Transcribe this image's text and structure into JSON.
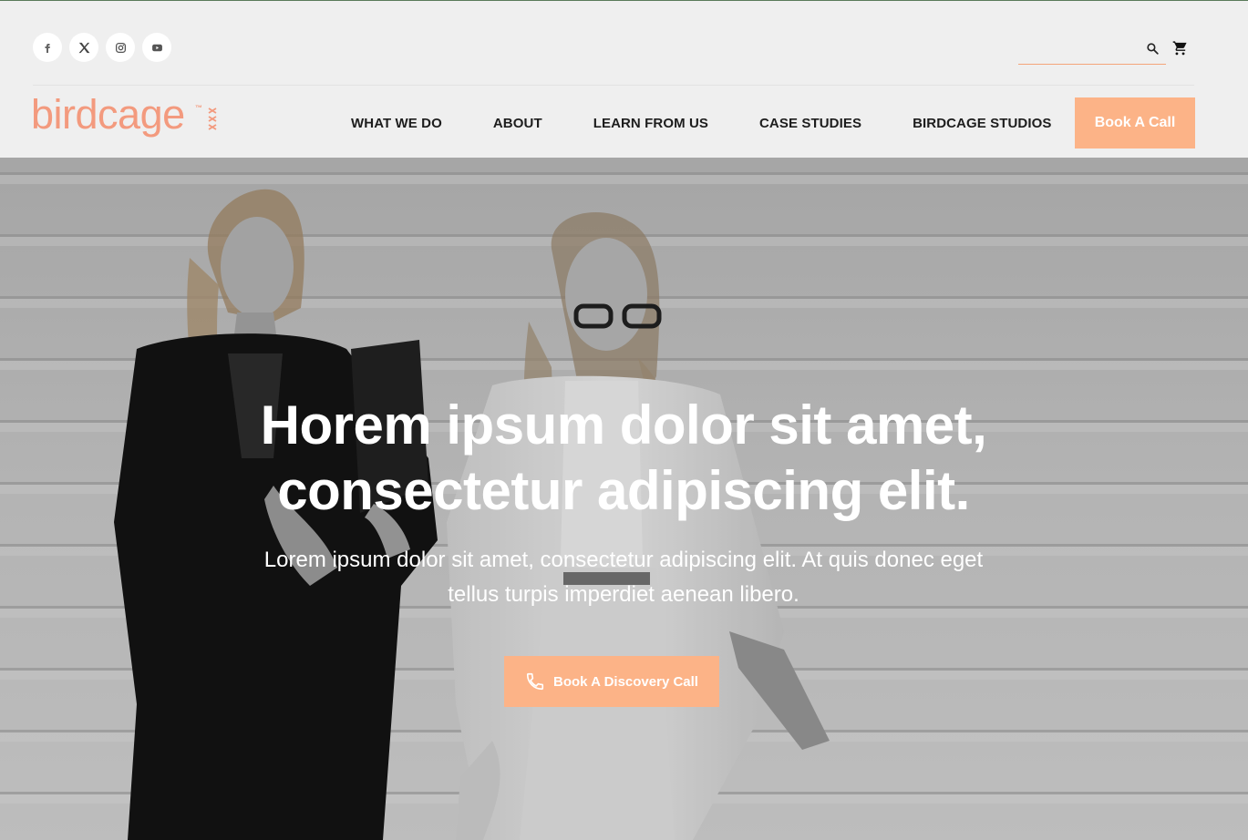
{
  "header": {
    "socials": [
      {
        "name": "facebook",
        "icon": "facebook-icon"
      },
      {
        "name": "x",
        "icon": "x-icon"
      },
      {
        "name": "instagram",
        "icon": "instagram-icon"
      },
      {
        "name": "youtube",
        "icon": "youtube-icon"
      }
    ],
    "search": {
      "placeholder": "",
      "value": ""
    },
    "logo": {
      "text": "birdcage",
      "tm": "™"
    },
    "nav": [
      {
        "label": "WHAT WE DO"
      },
      {
        "label": "ABOUT"
      },
      {
        "label": "LEARN FROM US"
      },
      {
        "label": "CASE STUDIES"
      },
      {
        "label": "BIRDCAGE STUDIOS"
      }
    ],
    "cta_label": "Book A Call"
  },
  "hero": {
    "title_line1": "Horem ipsum dolor sit amet,",
    "title_line2": "consectetur adipiscing elit.",
    "subtitle_line1": "Lorem ipsum dolor sit amet, consectetur adipiscing elit. At quis donec eget",
    "subtitle_line2": "tellus turpis imperdiet aenean libero.",
    "button_label": "Book A Discovery Call",
    "button_icon": "phone-icon"
  },
  "colors": {
    "accent": "#fcb387",
    "logo": "#f39a7e",
    "header_bg": "#efefef",
    "nav_text": "#1d1d1d"
  }
}
